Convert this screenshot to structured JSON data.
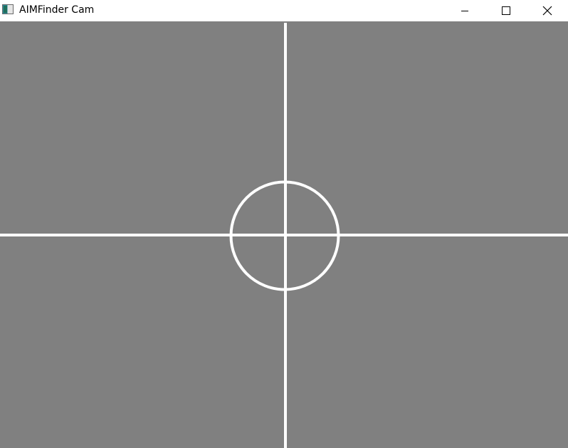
{
  "window": {
    "title": "AIMFinder Cam",
    "icon": "app-icon",
    "controls": {
      "minimize_icon": "minimize-icon",
      "maximize_icon": "maximize-icon",
      "close_icon": "close-icon"
    }
  },
  "camera_view": {
    "background_color": "#808080",
    "reticle_color": "#ffffff",
    "overlay": "crosshair-with-circle"
  }
}
